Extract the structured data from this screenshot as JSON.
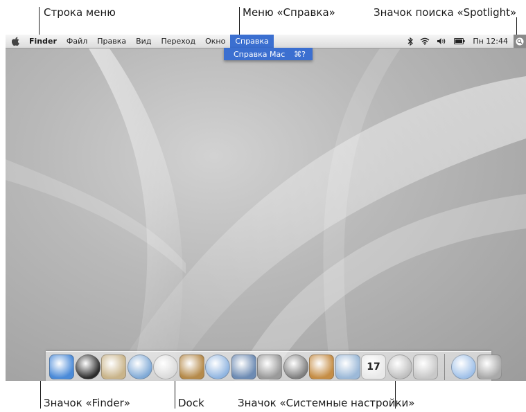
{
  "callouts": {
    "menubar": "Строка меню",
    "help_menu": "Меню «Справка»",
    "spotlight": "Значок поиска «Spotlight»",
    "finder_icon": "Значок «Finder»",
    "dock": "Dock",
    "system_prefs": "Значок «Системные настройки»"
  },
  "menubar": {
    "app_name": "Finder",
    "menus": [
      "Файл",
      "Правка",
      "Вид",
      "Переход",
      "Окно",
      "Справка"
    ],
    "selected_menu": "Справка",
    "clock": "Пн 12:44"
  },
  "help_dropdown": {
    "item_label": "Справка Mac",
    "item_shortcut": "⌘?"
  },
  "dock": {
    "items": [
      {
        "name": "finder",
        "color": "#4a8ad8"
      },
      {
        "name": "dashboard",
        "color": "#2b2b2b"
      },
      {
        "name": "mail",
        "color": "#c9b48a"
      },
      {
        "name": "safari",
        "color": "#7fa9d6"
      },
      {
        "name": "ichat",
        "color": "#dadada"
      },
      {
        "name": "address-book",
        "color": "#b58a4a"
      },
      {
        "name": "itunes",
        "color": "#8fb4e0"
      },
      {
        "name": "iphoto",
        "color": "#6d8bb3"
      },
      {
        "name": "imovie",
        "color": "#9a9a9a"
      },
      {
        "name": "idvd",
        "color": "#7f7f7f"
      },
      {
        "name": "garageband",
        "color": "#c58d45"
      },
      {
        "name": "preview",
        "color": "#9cb9d8"
      },
      {
        "name": "ical",
        "color": "#e9e9e9"
      },
      {
        "name": "time-machine",
        "color": "#bfbfbf"
      },
      {
        "name": "system-preferences",
        "color": "#c8c8c8"
      },
      {
        "name": "downloads",
        "color": "#9fc0e8"
      },
      {
        "name": "trash",
        "color": "#a9a9a9"
      }
    ],
    "ical_day": "17"
  }
}
